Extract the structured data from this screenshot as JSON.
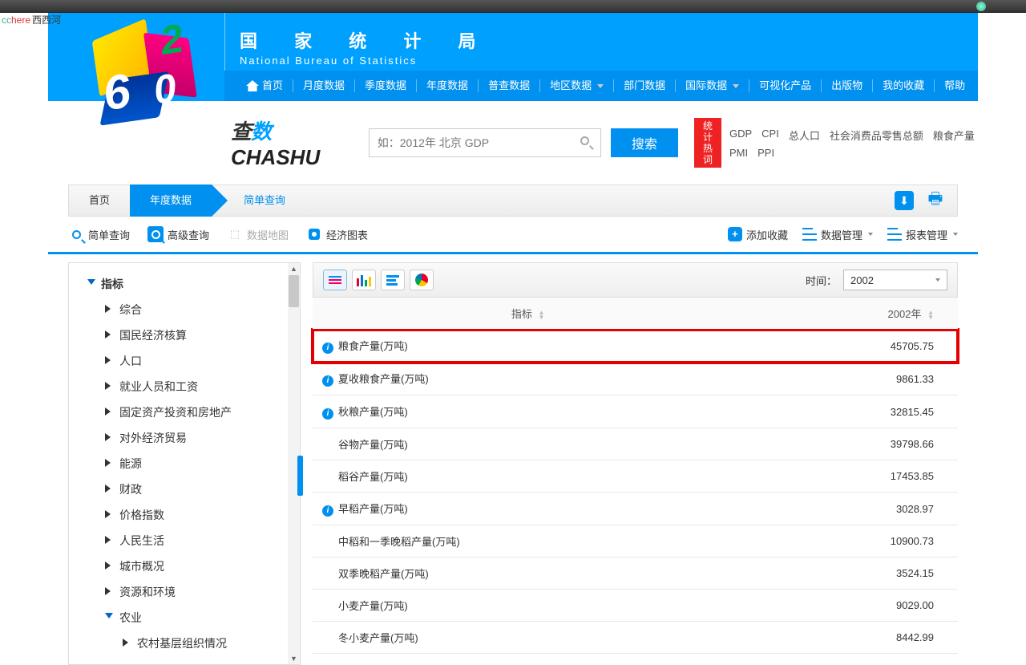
{
  "watermark": {
    "cc": "cc",
    "here": "here",
    "cn": "西西河"
  },
  "header": {
    "title_cn": "国 家 统 计 局",
    "title_en": "National Bureau of Statistics"
  },
  "nav": {
    "home": "首页",
    "items": [
      "月度数据",
      "季度数据",
      "年度数据",
      "普查数据",
      "地区数据",
      "部门数据",
      "国际数据",
      "可视化产品",
      "出版物",
      "我的收藏",
      "帮助"
    ]
  },
  "search": {
    "logo_cn1": "查",
    "logo_cn2": "数",
    "logo_en": "CHASHU",
    "placeholder": "如：2012年 北京 GDP",
    "button": "搜索",
    "hot_label_1": "统 计",
    "hot_label_2": "热 词",
    "hot_links": [
      "GDP",
      "CPI",
      "总人口",
      "社会消费品零售总额",
      "粮食产量",
      "PMI",
      "PPI"
    ]
  },
  "breadcrumb": {
    "home": "首页",
    "active": "年度数据",
    "link": "简单查询"
  },
  "toolbar": {
    "simple_query": "简单查询",
    "advanced_query": "高级查询",
    "data_map": "数据地图",
    "economic_chart": "经济图表",
    "add_favorite": "添加收藏",
    "data_manage": "数据管理",
    "report_manage": "报表管理"
  },
  "sidebar": {
    "root": "指标",
    "items": [
      "综合",
      "国民经济核算",
      "人口",
      "就业人员和工资",
      "固定资产投资和房地产",
      "对外经济贸易",
      "能源",
      "财政",
      "价格指数",
      "人民生活",
      "城市概况",
      "资源和环境"
    ],
    "expanded": "农业",
    "sub": "农村基层组织情况"
  },
  "content": {
    "time_label": "时间：",
    "time_value": "2002",
    "col_indicator": "指标",
    "col_year": "2002年",
    "rows": [
      {
        "name": "粮食产量(万吨)",
        "value": "45705.75",
        "info": true,
        "indent": 0,
        "highlight": true
      },
      {
        "name": "夏收粮食产量(万吨)",
        "value": "9861.33",
        "info": true,
        "indent": 0
      },
      {
        "name": "秋粮产量(万吨)",
        "value": "32815.45",
        "info": true,
        "indent": 0
      },
      {
        "name": "谷物产量(万吨)",
        "value": "39798.66",
        "info": false,
        "indent": 1
      },
      {
        "name": "稻谷产量(万吨)",
        "value": "17453.85",
        "info": false,
        "indent": 1
      },
      {
        "name": "早稻产量(万吨)",
        "value": "3028.97",
        "info": true,
        "indent": 0
      },
      {
        "name": "中稻和一季晚稻产量(万吨)",
        "value": "10900.73",
        "info": false,
        "indent": 1
      },
      {
        "name": "双季晚稻产量(万吨)",
        "value": "3524.15",
        "info": false,
        "indent": 1
      },
      {
        "name": "小麦产量(万吨)",
        "value": "9029.00",
        "info": false,
        "indent": 1
      },
      {
        "name": "冬小麦产量(万吨)",
        "value": "8442.99",
        "info": false,
        "indent": 1
      }
    ]
  }
}
